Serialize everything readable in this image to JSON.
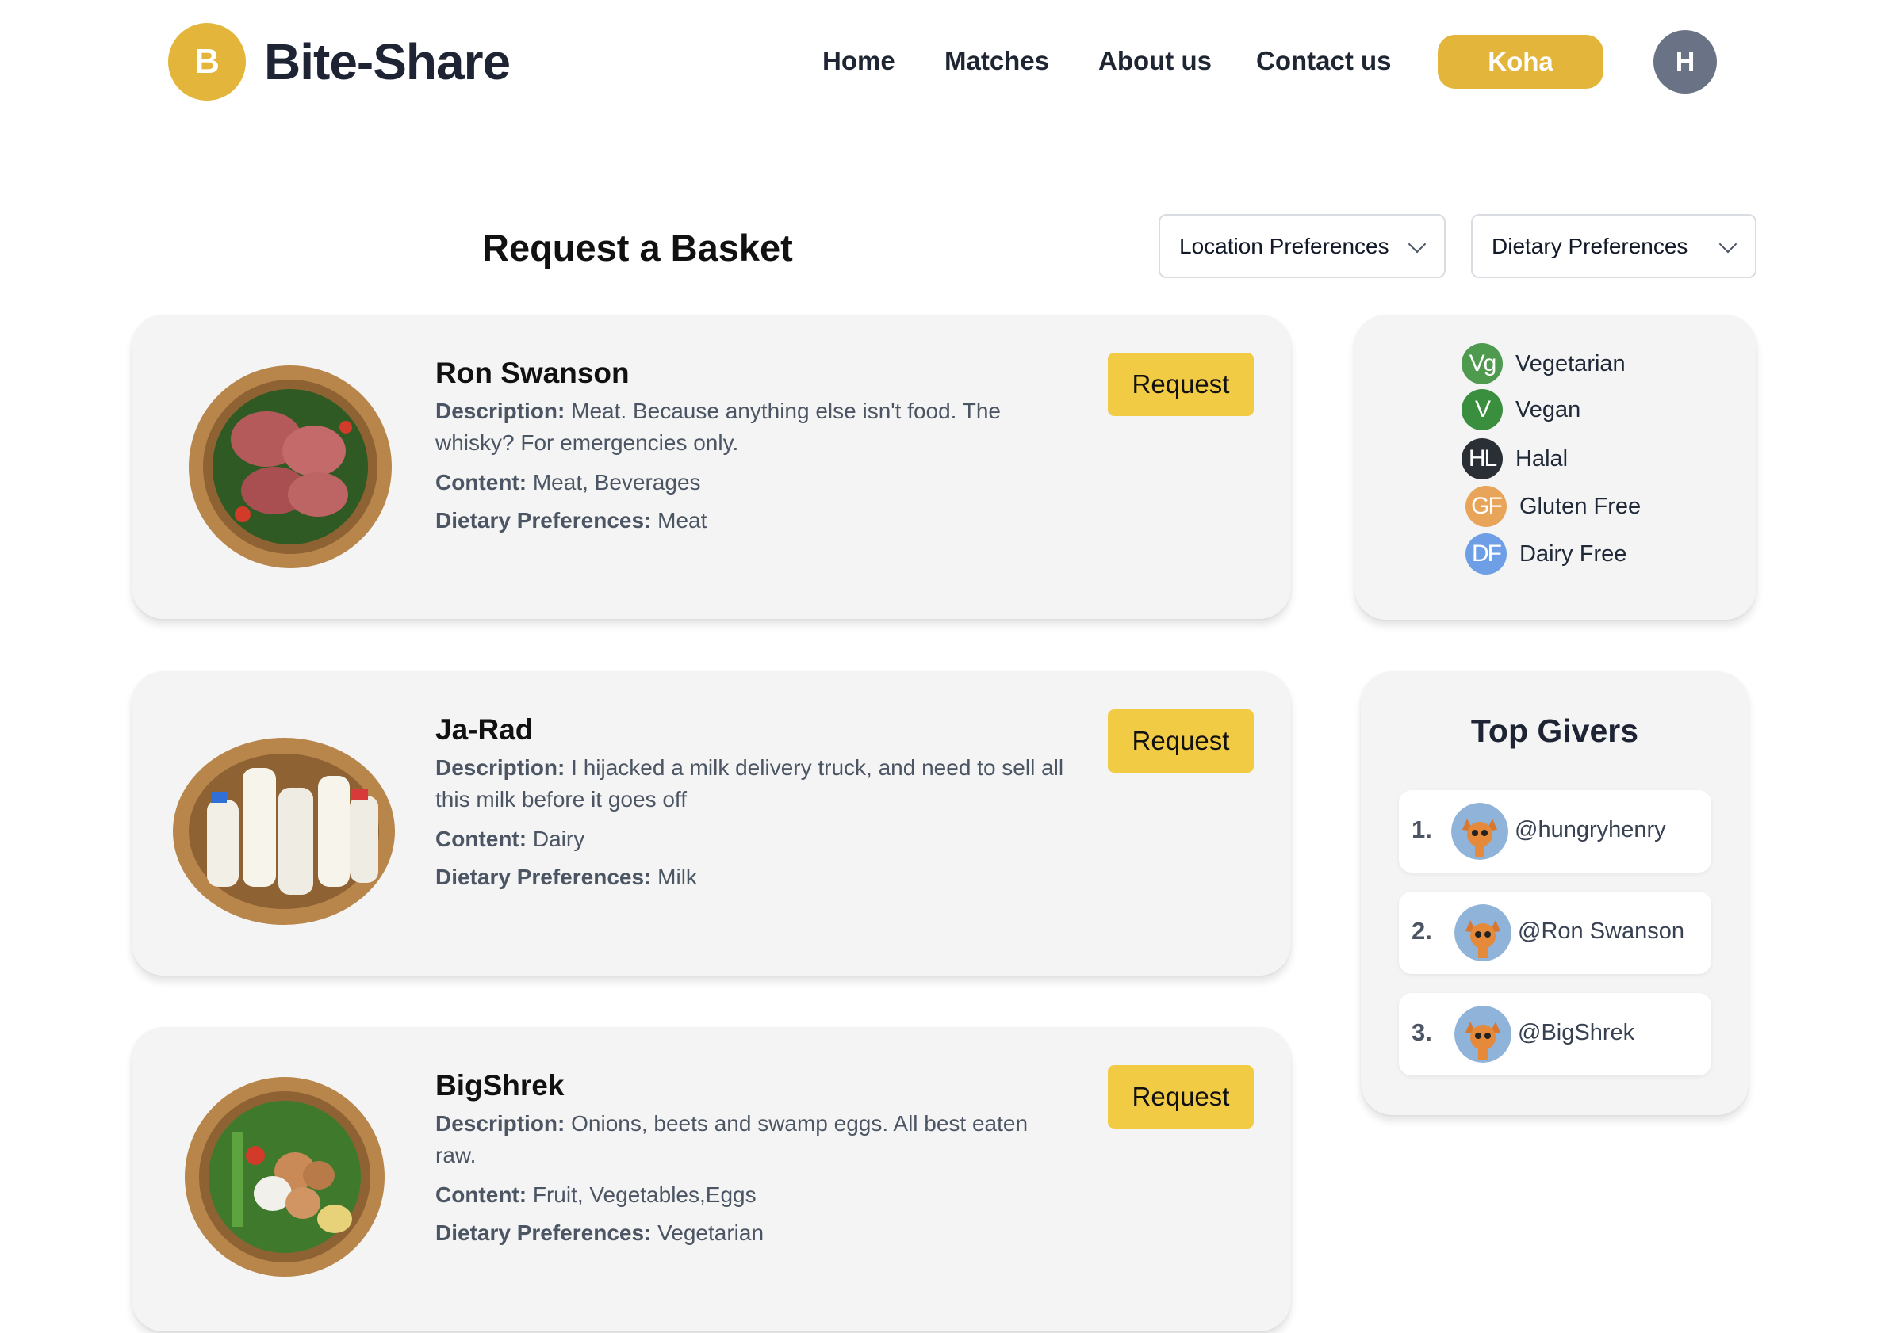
{
  "header": {
    "logo_letter": "B",
    "brand": "Bite-Share",
    "nav": [
      "Home",
      "Matches",
      "About us",
      "Contact us"
    ],
    "cta": "Koha",
    "user_initial": "H"
  },
  "main": {
    "title": "Request a Basket",
    "filters": {
      "location": "Location Preferences",
      "dietary": "Dietary Preferences"
    },
    "labels": {
      "description": "Description:",
      "content": "Content:",
      "dietary": "Dietary Preferences:"
    },
    "baskets": [
      {
        "name": "Ron Swanson",
        "description": "Meat. Because anything else isn't food. The whisky? For emergencies only.",
        "content": "Meat, Beverages",
        "dietary": "Meat",
        "button": "Request"
      },
      {
        "name": "Ja-Rad",
        "description": "I hijacked a milk delivery truck, and need to sell all this milk before it goes off",
        "content": "Dairy",
        "dietary": "Milk",
        "button": "Request"
      },
      {
        "name": "BigShrek",
        "description": "Onions, beets and swamp eggs. All best eaten raw.",
        "content": "Fruit, Vegetables,Eggs",
        "dietary": "Vegetarian",
        "button": "Request"
      }
    ]
  },
  "legend": [
    {
      "abbr": "Vg",
      "label": "Vegetarian",
      "color": "#4e9a4e"
    },
    {
      "abbr": "V",
      "label": "Vegan",
      "color": "#3a8f3f"
    },
    {
      "abbr": "HL",
      "label": "Halal",
      "color": "#2a2f36"
    },
    {
      "abbr": "GF",
      "label": "Gluten Free",
      "color": "#e8a55a"
    },
    {
      "abbr": "DF",
      "label": "Dairy Free",
      "color": "#6d9ee6"
    }
  ],
  "top_givers": {
    "title": "Top Givers",
    "list": [
      {
        "rank": "1.",
        "handle": "@hungryhenry"
      },
      {
        "rank": "2.",
        "handle": "@Ron Swanson"
      },
      {
        "rank": "3.",
        "handle": "@BigShrek"
      }
    ]
  },
  "colors": {
    "brand_gold": "#e3b63b",
    "request_yellow": "#f2cb45",
    "card_bg": "#f4f4f4"
  }
}
